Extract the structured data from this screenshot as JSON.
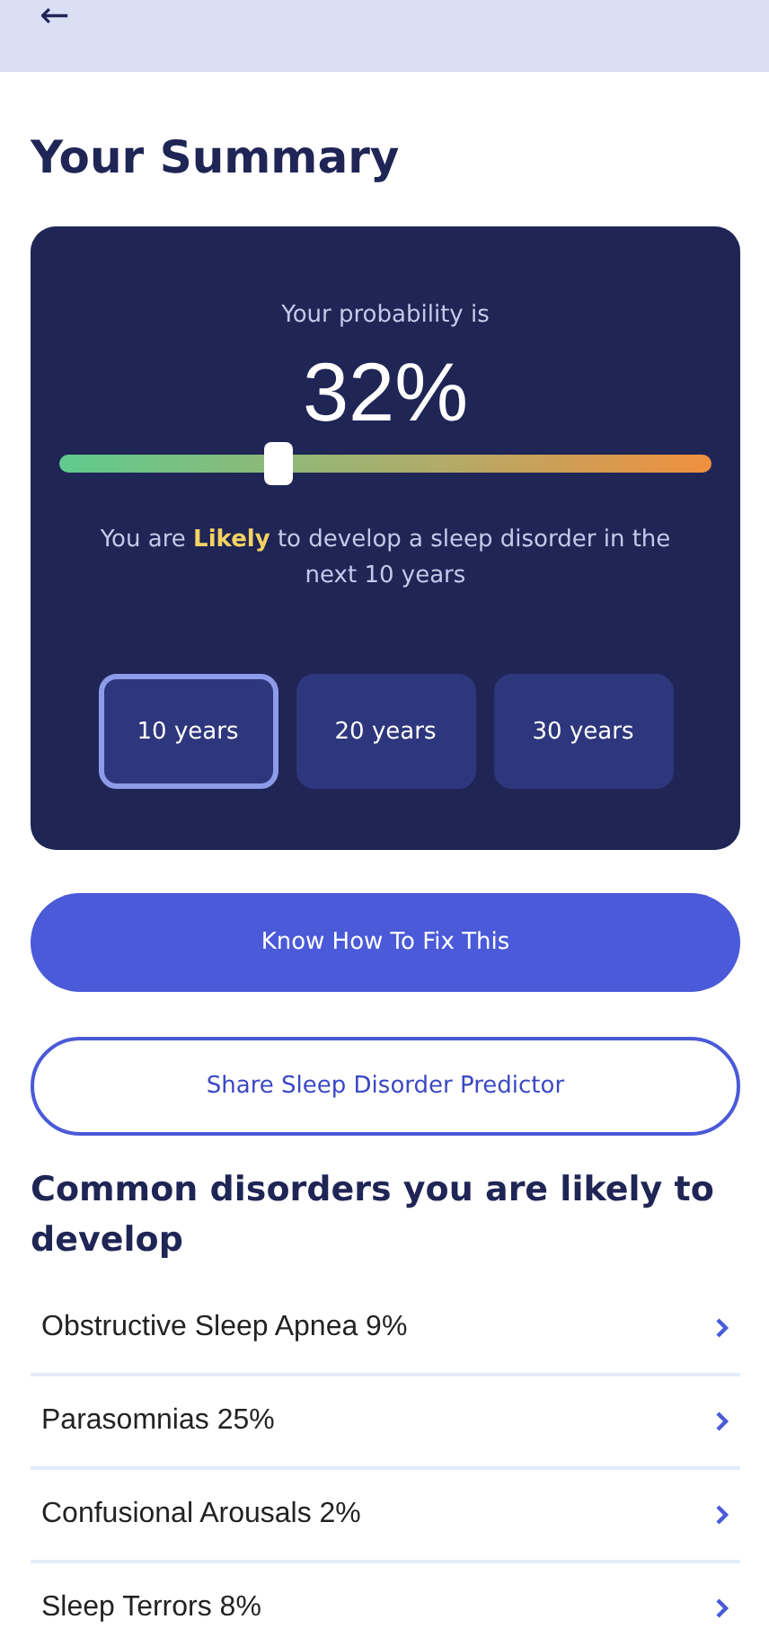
{
  "header": {
    "back_icon": "←"
  },
  "title": "Your Summary",
  "summary": {
    "caption": "Your probability is",
    "value": "32%",
    "slider": {
      "level": 0.335
    },
    "message": "You are **Likely** to develop a sleep disorder in the next 10 years",
    "periods": [
      {
        "label": "10 years",
        "selected": true
      },
      {
        "label": "20 years",
        "selected": false
      },
      {
        "label": "30 years",
        "selected": false
      }
    ]
  },
  "buttons": [
    {
      "label": "Know How To Fix This",
      "kind": "primary"
    },
    {
      "label": "Share Sleep Disorder Predictor",
      "kind": "outline"
    }
  ],
  "disorders_heading": "Common disorders you are likely to develop",
  "disorders": [
    {
      "label": "Obstructive Sleep Apnea 9%"
    },
    {
      "label": "Parasomnias 25%"
    },
    {
      "label": "Confusional Arousals 2%"
    },
    {
      "label": "Sleep Terrors 8%"
    }
  ]
}
